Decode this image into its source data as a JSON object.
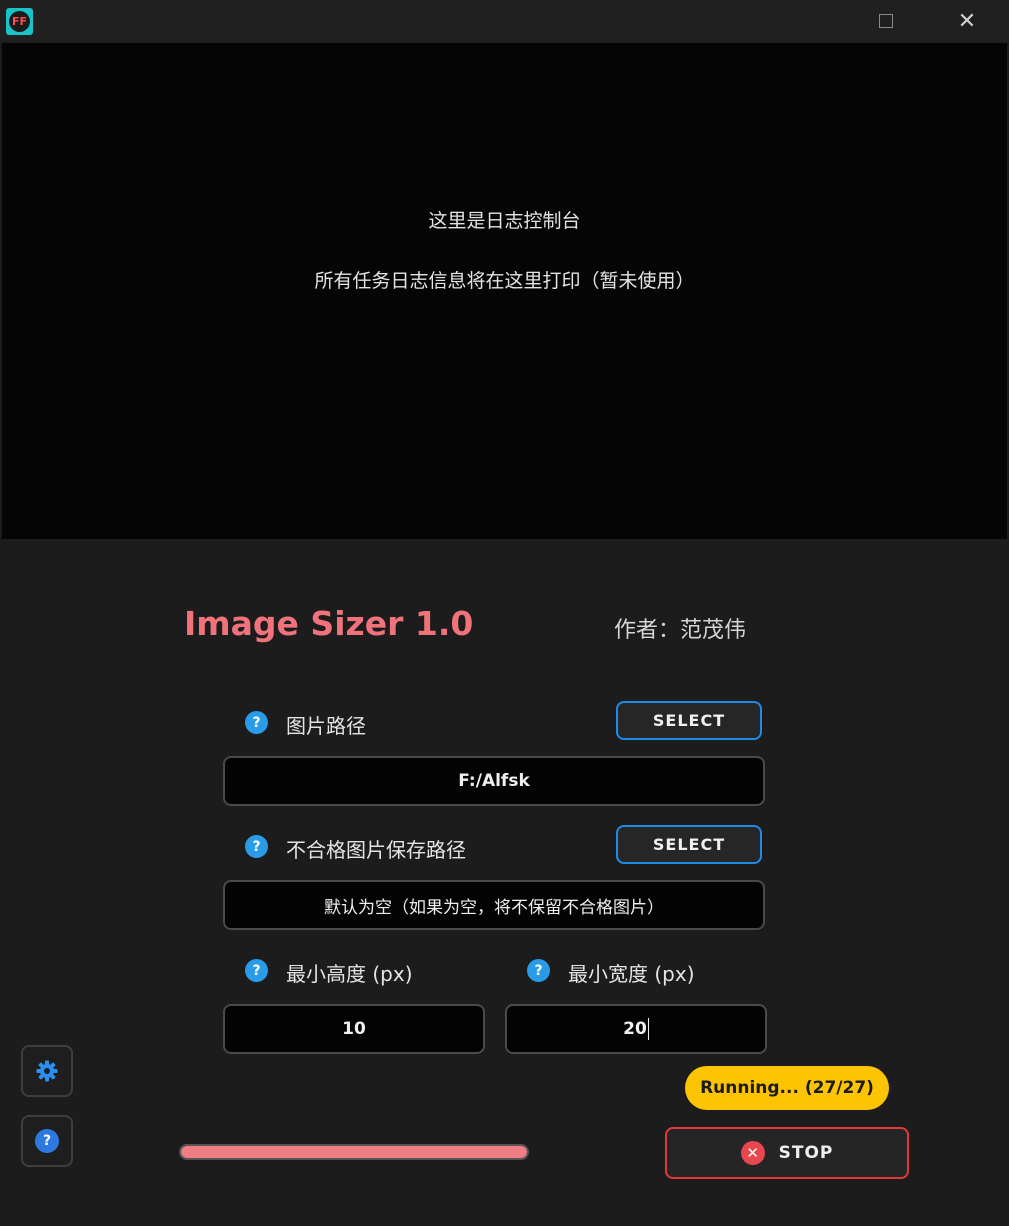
{
  "window": {
    "icon_text": "FF",
    "close_glyph": "✕"
  },
  "console": {
    "line1": "这里是日志控制台",
    "line2": "所有任务日志信息将在这里打印（暂未使用）"
  },
  "header": {
    "app_title": "Image Sizer 1.0",
    "author": "作者：范茂伟"
  },
  "form": {
    "image_path": {
      "label": "图片路径",
      "button": "SELECT",
      "value": "F:/Alfsk"
    },
    "reject_path": {
      "label": "不合格图片保存路径",
      "button": "SELECT",
      "value": "默认为空（如果为空，将不保留不合格图片）"
    },
    "min_height": {
      "label": "最小高度 (px)",
      "value": "10"
    },
    "min_width": {
      "label": "最小宽度 (px)",
      "value": "20"
    },
    "help_glyph": "?"
  },
  "footer": {
    "status": "Running... (27/27)",
    "stop_label": "STOP",
    "stop_glyph": "✕",
    "progress": 1.0,
    "settings_icon": "gear-icon",
    "help_icon": "help-icon"
  },
  "colors": {
    "accent_title": "#f0727a",
    "select_border": "#1e8be8",
    "status_bg": "#fcc402",
    "stop_border": "#e2383b",
    "progress_fill": "#f07d82"
  }
}
